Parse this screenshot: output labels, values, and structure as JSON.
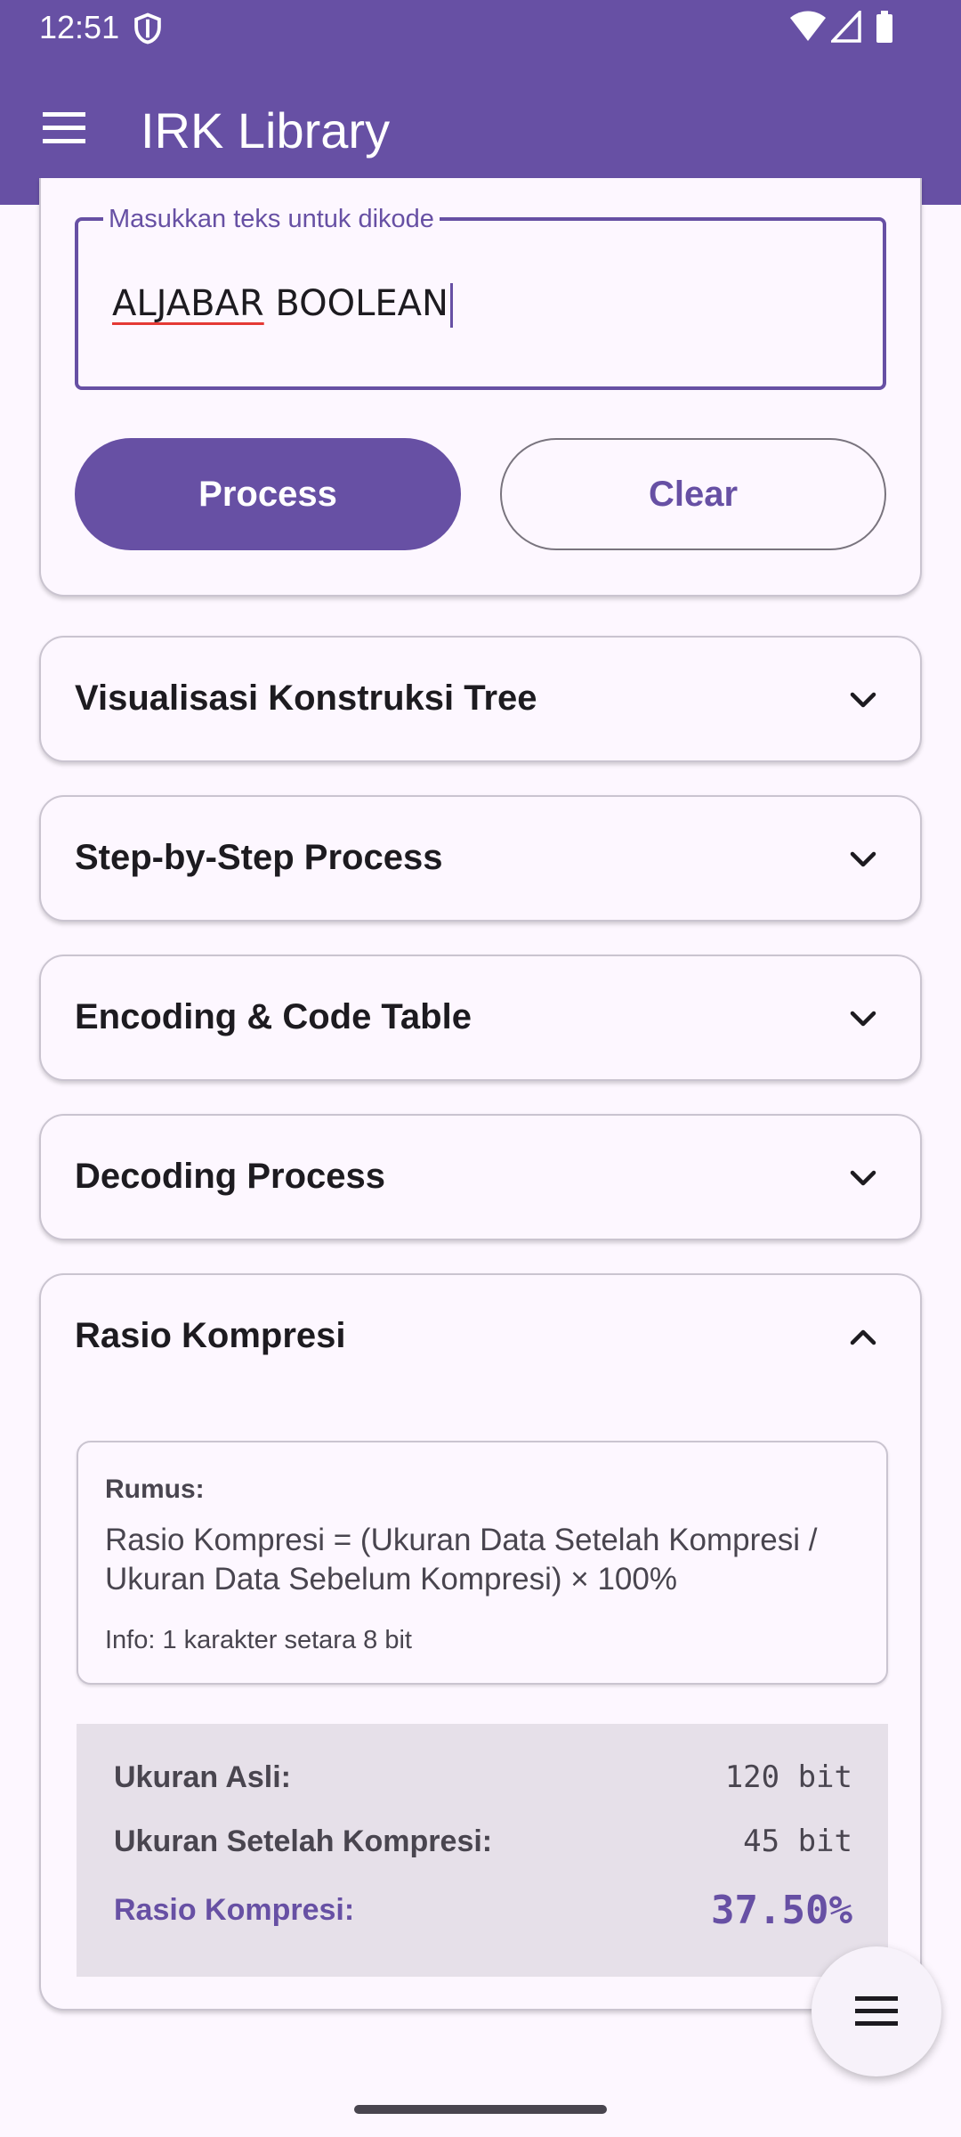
{
  "status": {
    "time": "12:51"
  },
  "app_bar": {
    "title": "IRK Library"
  },
  "input": {
    "label": "Masukkan teks untuk dikode",
    "value_word1": "ALJABAR",
    "value_rest": " BOOLEAN"
  },
  "buttons": {
    "process": "Process",
    "clear": "Clear"
  },
  "sections": [
    {
      "title": "Visualisasi Konstruksi Tree",
      "expanded": false
    },
    {
      "title": "Step-by-Step Process",
      "expanded": false
    },
    {
      "title": "Encoding & Code Table",
      "expanded": false
    },
    {
      "title": "Decoding Process",
      "expanded": false
    },
    {
      "title": "Rasio Kompresi",
      "expanded": true
    }
  ],
  "ratio": {
    "formula_label": "Rumus:",
    "formula_text": "Rasio Kompresi = (Ukuran Data Setelah Kompresi / Ukuran Data Sebelum Kompresi) × 100%",
    "info": "Info: 1 karakter setara 8 bit",
    "original_label": "Ukuran Asli:",
    "original_value": "120 bit",
    "compressed_label": "Ukuran Setelah Kompresi:",
    "compressed_value": "45 bit",
    "ratio_label": "Rasio Kompresi:",
    "ratio_value": "37.50%"
  },
  "colors": {
    "primary": "#6750a4",
    "surface": "#fdf7ff",
    "result_bg": "#e6e0e9"
  },
  "icons": {
    "status": [
      "shield-icon",
      "wifi-icon",
      "signal-icon",
      "battery-icon"
    ],
    "app_bar": "menu-icon",
    "fab": "menu-icon"
  }
}
